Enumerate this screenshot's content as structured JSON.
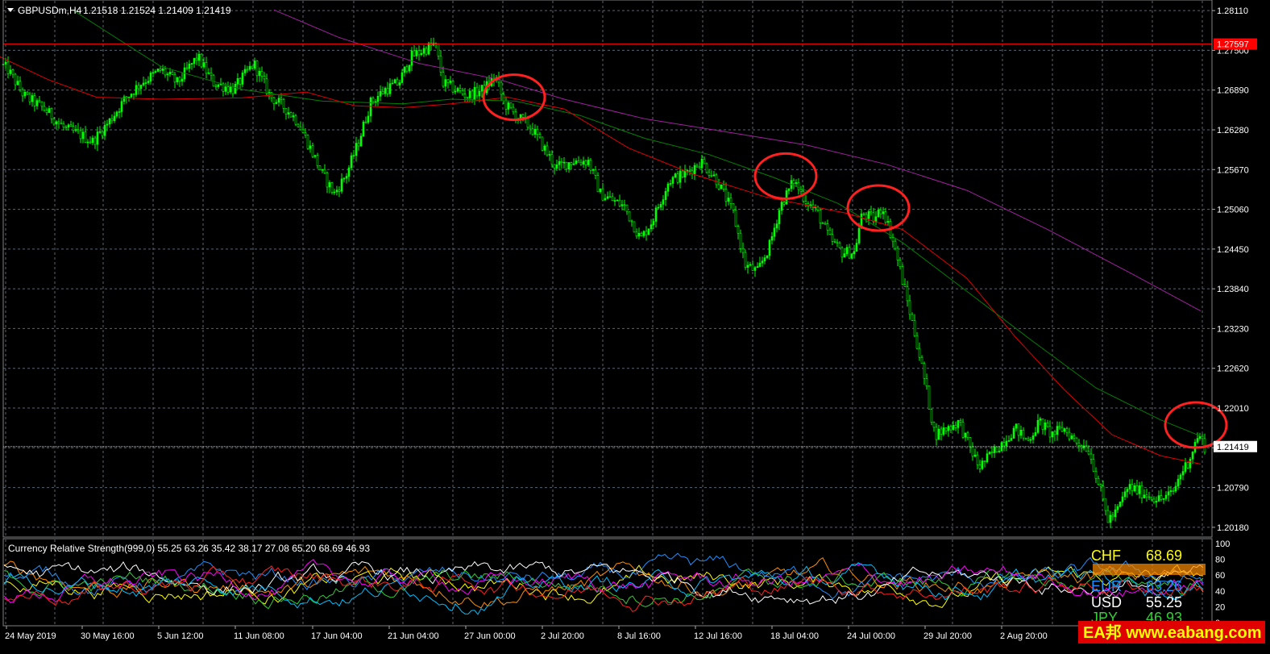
{
  "header": {
    "symbol_label": "GBPUSDm,H4",
    "ohlc_label": "1.21518 1.21524 1.21409 1.21419"
  },
  "price_axis": {
    "ticks": [
      "1.28110",
      "1.27500",
      "1.26890",
      "1.26280",
      "1.25670",
      "1.25060",
      "1.24450",
      "1.23840",
      "1.23230",
      "1.22620",
      "1.22010",
      "1.21400",
      "1.20790",
      "1.20180"
    ],
    "tick_values": [
      1.2811,
      1.275,
      1.2689,
      1.2628,
      1.2567,
      1.2506,
      1.2445,
      1.2384,
      1.2323,
      1.2262,
      1.2201,
      1.214,
      1.2079,
      1.2018
    ],
    "hline_label": "1.27597",
    "hline_value": 1.27597,
    "bid_label": "1.21419",
    "bid_value": 1.21419,
    "ylim": [
      1.2003,
      1.2826
    ]
  },
  "time_axis": {
    "ticks": [
      "24 May 2019",
      "30 May 16:00",
      "5 Jun 12:00",
      "11 Jun 08:00",
      "17 Jun 04:00",
      "21 Jun 04:00",
      "27 Jun 00:00",
      "2 Jul 20:00",
      "8 Jul 16:00",
      "12 Jul 16:00",
      "18 Jul 04:00",
      "24 Jul 00:00",
      "29 Jul 20:00",
      "2 Aug 20:00"
    ]
  },
  "indicator": {
    "title": "Currency Relative Strength(999,0) 55.25 63.26 35.42 38.17 27.08 65.20 68.69 46.93",
    "ticks": [
      "100",
      "80",
      "60",
      "40",
      "20",
      "0"
    ],
    "tick_values": [
      100,
      80,
      60,
      40,
      20,
      0
    ],
    "legend": [
      {
        "name": "CHF",
        "value": "68.69",
        "color": "#ffff00"
      },
      {
        "name": "",
        "value": "",
        "color": "#ff8c00"
      },
      {
        "name": "EUR",
        "value": "63.26",
        "color": "#1e90ff"
      },
      {
        "name": "USD",
        "value": "55.25",
        "color": "#ffffff"
      },
      {
        "name": "JPY",
        "value": "46.93",
        "color": "#32cd32"
      }
    ],
    "line_colors": [
      "#ffff00",
      "#ff8c00",
      "#1e90ff",
      "#ffffff",
      "#32cd32",
      "#ff00ff",
      "#00bfff",
      "#ff2020"
    ]
  },
  "watermark": {
    "text": "EA邦 www.eabang.com",
    "color": "#ffff00",
    "bg": "#e00000"
  },
  "colors": {
    "candle": "#00ff00",
    "ma_red": "#e00000",
    "ma_green": "#008000",
    "ma_purple": "#a020a0",
    "hline": "#ff0000",
    "grid": "#5a6470",
    "circle": "#ff2020"
  },
  "chart_data": {
    "type": "candlestick",
    "anchors_price": [
      [
        0,
        1.273
      ],
      [
        10,
        1.272
      ],
      [
        30,
        1.268
      ],
      [
        55,
        1.266
      ],
      [
        80,
        1.263
      ],
      [
        100,
        1.262
      ],
      [
        115,
        1.261
      ],
      [
        135,
        1.264
      ],
      [
        155,
        1.2675
      ],
      [
        175,
        1.27
      ],
      [
        200,
        1.272
      ],
      [
        220,
        1.27
      ],
      [
        245,
        1.274
      ],
      [
        265,
        1.27
      ],
      [
        290,
        1.269
      ],
      [
        315,
        1.273
      ],
      [
        335,
        1.268
      ],
      [
        355,
        1.266
      ],
      [
        370,
        1.264
      ],
      [
        385,
        1.26
      ],
      [
        400,
        1.256
      ],
      [
        415,
        1.253
      ],
      [
        430,
        1.256
      ],
      [
        445,
        1.261
      ],
      [
        460,
        1.267
      ],
      [
        478,
        1.269
      ],
      [
        495,
        1.27
      ],
      [
        510,
        1.274
      ],
      [
        525,
        1.275
      ],
      [
        540,
        1.276
      ],
      [
        550,
        1.27
      ],
      [
        565,
        1.269
      ],
      [
        580,
        1.268
      ],
      [
        600,
        1.269
      ],
      [
        615,
        1.271
      ],
      [
        625,
        1.267
      ],
      [
        640,
        1.265
      ],
      [
        660,
        1.263
      ],
      [
        675,
        1.26
      ],
      [
        690,
        1.257
      ],
      [
        710,
        1.258
      ],
      [
        730,
        1.258
      ],
      [
        745,
        1.253
      ],
      [
        760,
        1.252
      ],
      [
        775,
        1.251
      ],
      [
        795,
        1.246
      ],
      [
        810,
        1.249
      ],
      [
        830,
        1.255
      ],
      [
        850,
        1.256
      ],
      [
        870,
        1.258
      ],
      [
        890,
        1.255
      ],
      [
        910,
        1.25
      ],
      [
        925,
        1.242
      ],
      [
        940,
        1.241
      ],
      [
        955,
        1.245
      ],
      [
        968,
        1.251
      ],
      [
        985,
        1.255
      ],
      [
        1000,
        1.252
      ],
      [
        1015,
        1.25
      ],
      [
        1030,
        1.246
      ],
      [
        1045,
        1.244
      ],
      [
        1060,
        1.244
      ],
      [
        1070,
        1.25
      ],
      [
        1085,
        1.249
      ],
      [
        1095,
        1.251
      ],
      [
        1110,
        1.245
      ],
      [
        1125,
        1.237
      ],
      [
        1138,
        1.23
      ],
      [
        1148,
        1.224
      ],
      [
        1160,
        1.216
      ],
      [
        1175,
        1.217
      ],
      [
        1190,
        1.218
      ],
      [
        1200,
        1.215
      ],
      [
        1215,
        1.211
      ],
      [
        1230,
        1.213
      ],
      [
        1245,
        1.215
      ],
      [
        1260,
        1.217
      ],
      [
        1275,
        1.215
      ],
      [
        1290,
        1.218
      ],
      [
        1305,
        1.216
      ],
      [
        1320,
        1.217
      ],
      [
        1335,
        1.215
      ],
      [
        1350,
        1.214
      ],
      [
        1360,
        1.21
      ],
      [
        1375,
        1.203
      ],
      [
        1385,
        1.204
      ],
      [
        1400,
        1.208
      ],
      [
        1420,
        1.207
      ],
      [
        1440,
        1.206
      ],
      [
        1455,
        1.207
      ],
      [
        1465,
        1.21
      ],
      [
        1475,
        1.212
      ],
      [
        1487,
        1.216
      ],
      [
        1495,
        1.2142
      ]
    ],
    "ma_red": [
      [
        0,
        1.274
      ],
      [
        60,
        1.2705
      ],
      [
        120,
        1.2678
      ],
      [
        200,
        1.2675
      ],
      [
        300,
        1.2677
      ],
      [
        380,
        1.2686
      ],
      [
        440,
        1.2665
      ],
      [
        500,
        1.2662
      ],
      [
        560,
        1.2668
      ],
      [
        630,
        1.2678
      ],
      [
        700,
        1.266
      ],
      [
        780,
        1.26
      ],
      [
        860,
        1.256
      ],
      [
        950,
        1.2525
      ],
      [
        1050,
        1.25
      ],
      [
        1120,
        1.2475
      ],
      [
        1200,
        1.24
      ],
      [
        1260,
        1.231
      ],
      [
        1320,
        1.223
      ],
      [
        1380,
        1.216
      ],
      [
        1440,
        1.2128
      ],
      [
        1490,
        1.2115
      ]
    ],
    "ma_green": [
      [
        90,
        1.2812
      ],
      [
        200,
        1.2725
      ],
      [
        300,
        1.269
      ],
      [
        400,
        1.2672
      ],
      [
        500,
        1.2668
      ],
      [
        560,
        1.2675
      ],
      [
        640,
        1.2672
      ],
      [
        720,
        1.265
      ],
      [
        800,
        1.2615
      ],
      [
        880,
        1.259
      ],
      [
        960,
        1.2555
      ],
      [
        1040,
        1.2515
      ],
      [
        1120,
        1.2455
      ],
      [
        1200,
        1.238
      ],
      [
        1280,
        1.2305
      ],
      [
        1360,
        1.2232
      ],
      [
        1440,
        1.2183
      ],
      [
        1490,
        1.2158
      ]
    ],
    "ma_purple": [
      [
        340,
        1.2812
      ],
      [
        420,
        1.277
      ],
      [
        520,
        1.273
      ],
      [
        620,
        1.2705
      ],
      [
        700,
        1.2675
      ],
      [
        800,
        1.2645
      ],
      [
        900,
        1.2625
      ],
      [
        1000,
        1.2605
      ],
      [
        1100,
        1.2575
      ],
      [
        1200,
        1.2535
      ],
      [
        1300,
        1.2475
      ],
      [
        1400,
        1.241
      ],
      [
        1490,
        1.235
      ]
    ],
    "circles": [
      [
        638,
        1.2678
      ],
      [
        975,
        1.2557
      ],
      [
        1090,
        1.2508
      ],
      [
        1484,
        1.2175
      ]
    ]
  }
}
